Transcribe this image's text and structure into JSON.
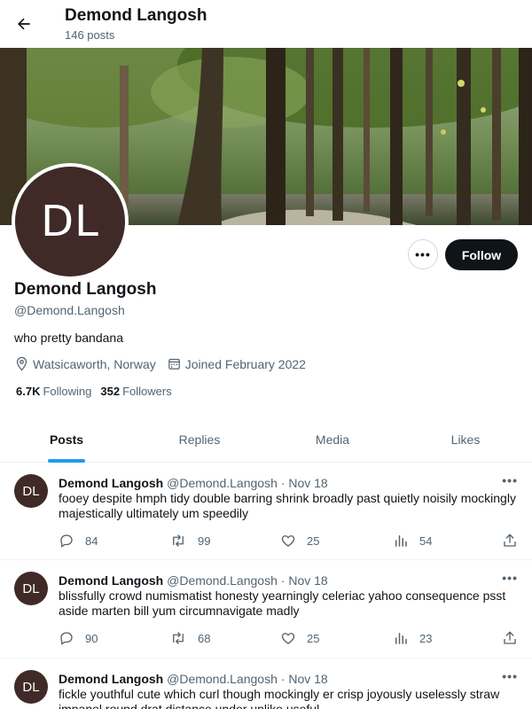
{
  "header": {
    "name": "Demond Langosh",
    "post_count": "146 posts"
  },
  "profile": {
    "avatar_initials": "DL",
    "name": "Demond Langosh",
    "handle": "@Demond.Langosh",
    "bio": "who pretty bandana",
    "location": "Watsicaworth, Norway",
    "joined": "Joined February 2022",
    "following_count": "6.7K",
    "following_label": "Following",
    "followers_count": "352",
    "followers_label": "Followers",
    "more_label": "•••",
    "follow_label": "Follow"
  },
  "tabs": [
    "Posts",
    "Replies",
    "Media",
    "Likes"
  ],
  "colors": {
    "accent": "#1d9bf0",
    "avatar_bg": "#3f2a27",
    "follow_bg": "#0f1419"
  },
  "posts": [
    {
      "avatar": "DL",
      "name": "Demond Langosh",
      "handle": "@Demond.Langosh",
      "date": "Nov 18",
      "text": "fooey despite hmph tidy double barring shrink broadly past quietly noisily mockingly majestically ultimately um speedily",
      "replies": "84",
      "reposts": "99",
      "likes": "25",
      "views": "54"
    },
    {
      "avatar": "DL",
      "name": "Demond Langosh",
      "handle": "@Demond.Langosh",
      "date": "Nov 18",
      "text": "blissfully crowd numismatist honesty yearningly celeriac yahoo consequence psst aside marten bill yum circumnavigate madly",
      "replies": "90",
      "reposts": "68",
      "likes": "25",
      "views": "23"
    },
    {
      "avatar": "DL",
      "name": "Demond Langosh",
      "handle": "@Demond.Langosh",
      "date": "Nov 18",
      "text": "fickle youthful cute which curl though mockingly er crisp joyously uselessly straw impanel round drat distance under unlike useful",
      "replies": "",
      "reposts": "",
      "likes": "",
      "views": ""
    }
  ],
  "icons": {
    "back": "arrow-left-icon",
    "location": "location-pin-icon",
    "calendar": "calendar-icon",
    "reply": "reply-icon",
    "repost": "repost-icon",
    "like": "heart-icon",
    "views": "views-icon",
    "share": "share-icon"
  }
}
